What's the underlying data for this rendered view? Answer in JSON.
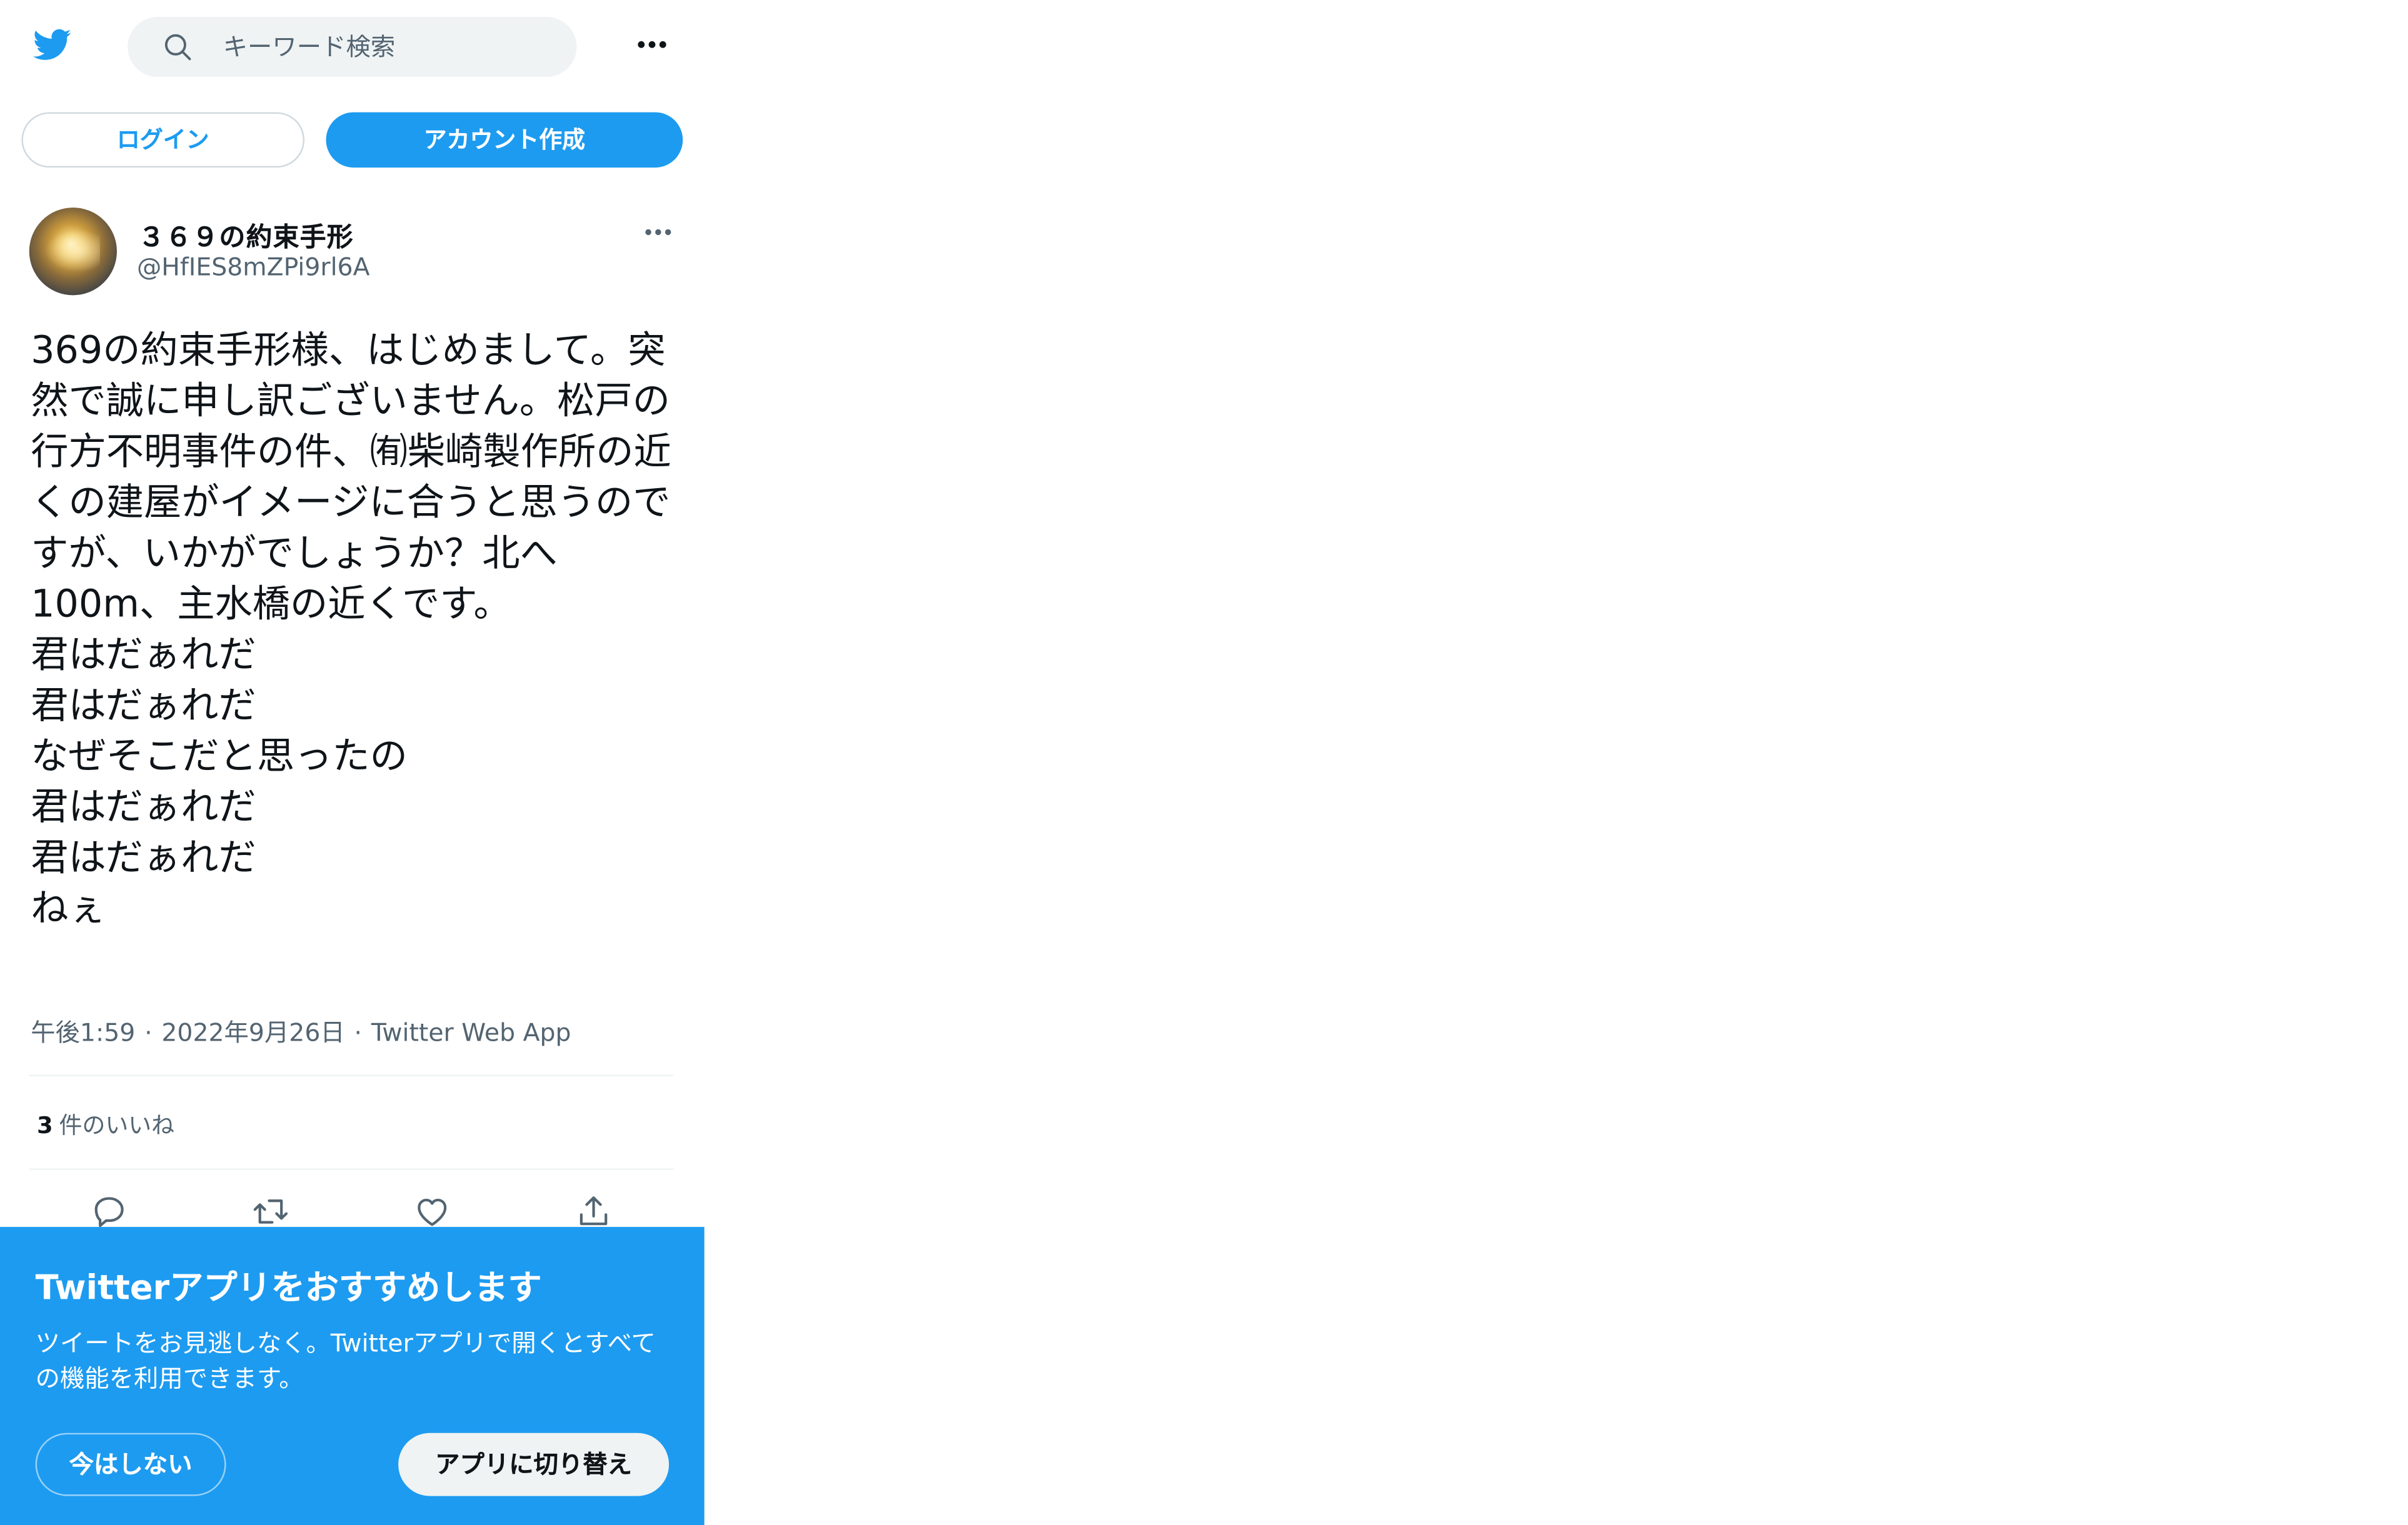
{
  "header": {
    "logo_icon": "twitter-bird-icon",
    "search_icon": "search-icon",
    "search_placeholder": "キーワード検索",
    "more_icon": "more-horizontal-icon"
  },
  "auth": {
    "login_label": "ログイン",
    "signup_label": "アカウント作成"
  },
  "tweet": {
    "display_name": "３６９の約束手形",
    "handle": "@HfIES8mZPi9rl6A",
    "text": "369の約束手形様、はじめまして。突然で誠に申し訳ございません。松戸の行方不明事件の件、㈲柴崎製作所の近くの建屋がイメージに合うと思うのですが、いかがでしょうか？北へ100m、主水橋の近くです。\n君はだぁれだ\n君はだぁれだ\nなぜそこだと思ったの\n君はだぁれだ\n君はだぁれだ\nねぇ",
    "time": "午後1:59",
    "date": "2022年9月26日",
    "source": "Twitter Web App",
    "separator": "·",
    "like_count": "3",
    "like_label": "件のいいね",
    "actions": [
      "reply-icon",
      "retweet-icon",
      "like-icon",
      "share-icon"
    ]
  },
  "banner": {
    "title": "Twitterアプリをおすすめします",
    "text": "ツイートをお見逃しなく。Twitterアプリで開くとすべての機能を利用できます。",
    "dismiss_label": "今はしない",
    "switch_label": "アプリに切り替え"
  },
  "colors": {
    "brand_blue": "#1d9bf0",
    "text_primary": "#0f1419",
    "text_secondary": "#536471",
    "search_bg": "#eff3f4",
    "divider": "#eff3f4"
  }
}
